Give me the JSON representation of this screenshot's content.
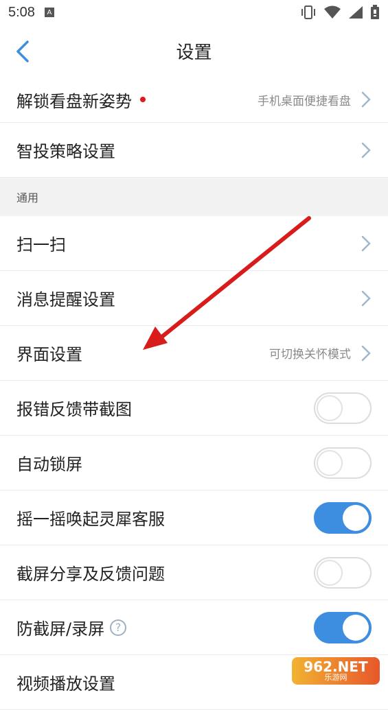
{
  "statusbar": {
    "time": "5:08",
    "notif_letter": "A"
  },
  "header": {
    "title": "设置"
  },
  "rows_top": [
    {
      "label": "解锁看盘新姿势",
      "hint": "手机桌面便捷看盘",
      "dot": true
    },
    {
      "label": "智投策略设置",
      "hint": ""
    }
  ],
  "section": {
    "title": "通用"
  },
  "rows_nav": [
    {
      "label": "扫一扫",
      "hint": ""
    },
    {
      "label": "消息提醒设置",
      "hint": ""
    },
    {
      "label": "界面设置",
      "hint": "可切换关怀模式"
    }
  ],
  "rows_toggle": [
    {
      "label": "报错反馈带截图",
      "on": false
    },
    {
      "label": "自动锁屏",
      "on": false
    },
    {
      "label": "摇一摇唤起灵犀客服",
      "on": true
    },
    {
      "label": "截屏分享及反馈问题",
      "on": false
    },
    {
      "label": "防截屏/录屏",
      "on": true,
      "help": "?"
    }
  ],
  "last_row": {
    "label": "视频播放设置"
  },
  "watermark": {
    "line1": "962.NET",
    "line2": "乐游网"
  },
  "colors": {
    "accent": "#3d8ee0",
    "dot": "#e01818",
    "arrow": "#d81c1c"
  }
}
